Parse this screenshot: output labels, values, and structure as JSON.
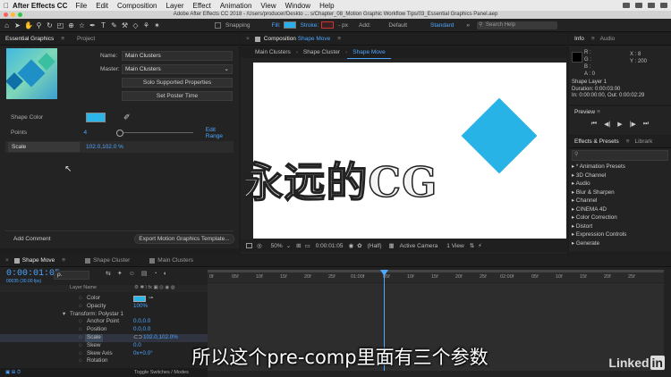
{
  "menubar": {
    "app": "After Effects CC",
    "items": [
      "File",
      "Edit",
      "Composition",
      "Layer",
      "Effect",
      "Animation",
      "View",
      "Window",
      "Help"
    ]
  },
  "titlebar": {
    "title": "Adobe After Effects CC 2018 - /Users/producer/Deskto ... s/Chapter_08_Motion Graphic Workflow Tips/03_Essential Graphics Panel.aep"
  },
  "toolbar": {
    "snapping": "Snapping",
    "fill": "Fill:",
    "stroke": "Stroke:",
    "stroke_px": "- px",
    "add": "Add:",
    "workspace_default": "Default",
    "workspace_standard": "Standard",
    "search_placeholder": "Search Help",
    "colors": {
      "fill": "#2aaee8"
    }
  },
  "essential_graphics": {
    "tabs": [
      "Essential Graphics",
      "Project"
    ],
    "name_label": "Name:",
    "name_value": "Main Clusters",
    "master_label": "Master:",
    "master_value": "Main Clusters",
    "solo_button": "Solo Supported Properties",
    "poster_button": "Set Poster Time",
    "shape_color_label": "Shape Color",
    "points_label": "Points",
    "points_value": "4",
    "edit_range": "Edit Range",
    "scale_label": "Scale",
    "scale_value": "102.0,102.0 %",
    "add_comment": "Add Comment",
    "export_button": "Export Motion Graphics Template..."
  },
  "composition": {
    "tab_prefix": "Composition",
    "tab_name": "Shape Move",
    "breadcrumbs": [
      "Main Clusters",
      "Shape Cluster",
      "Shape Move"
    ],
    "zoom": "50%",
    "timecode": "0:00:01:05",
    "resolution": "(Half)",
    "camera": "Active Camera",
    "views": "1 View",
    "shape_color": "#27b3e6"
  },
  "info": {
    "tabs": [
      "Info",
      "Audio"
    ],
    "rgba": [
      "R :",
      "G :",
      "B :",
      "A : 0"
    ],
    "x": "X : 8",
    "y": "Y : 200",
    "layer": "Shape Layer 1",
    "duration": "Duration: 0:00:03:00",
    "in_out": "In: 0:00:00:00, Out: 0:00:02:29"
  },
  "preview": {
    "title": "Preview"
  },
  "effects": {
    "tabs": [
      "Effects & Presets",
      "Librark"
    ],
    "items": [
      "* Animation Presets",
      "3D Channel",
      "Audio",
      "Blur & Sharpen",
      "Channel",
      "CINEMA 4D",
      "Color Correction",
      "Distort",
      "Expression Controls",
      "Generate"
    ]
  },
  "timeline": {
    "tabs": [
      "Shape Move",
      "Shape Cluster",
      "Main Clusters"
    ],
    "timecode": "0:00:01:05",
    "fps": "00035 (30.00 fps)",
    "search_placeholder": "ρ.",
    "layer_name_header": "Layer Name",
    "layers": [
      {
        "name": "Color",
        "value": "",
        "indent": 2
      },
      {
        "name": "Opacity",
        "value": "100%",
        "indent": 2
      },
      {
        "name": "Transform: Polystar 1",
        "value": "",
        "indent": 1
      },
      {
        "name": "Anchor Point",
        "value": "0.0,0.0",
        "indent": 2
      },
      {
        "name": "Position",
        "value": "0.0,0.0",
        "indent": 2
      },
      {
        "name": "Scale",
        "value": "102.0,102.0%",
        "indent": 2
      },
      {
        "name": "Skew",
        "value": "0.0",
        "indent": 2
      },
      {
        "name": "Skew Axis",
        "value": "0x+0.0°",
        "indent": 2
      },
      {
        "name": "Rotation",
        "value": "0x+0.0°",
        "indent": 2
      }
    ],
    "ruler": [
      "0f",
      "05f",
      "10f",
      "15f",
      "20f",
      "25f",
      "01:00f",
      "05f",
      "10f",
      "15f",
      "20f",
      "25f",
      "02:00f",
      "05f",
      "10f",
      "15f",
      "20f",
      "25f"
    ],
    "toggle_label": "Toggle Switches / Modes"
  },
  "overlay": {
    "watermark": "永远的CG",
    "subtitle": "所以这个pre-comp里面有三个参数",
    "logo_text": "Linked",
    "logo_in": "in"
  }
}
